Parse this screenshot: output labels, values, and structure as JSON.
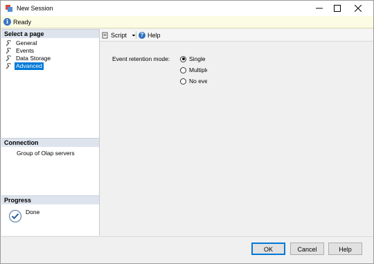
{
  "window": {
    "title": "New Session"
  },
  "status": {
    "text": "Ready"
  },
  "select_page": {
    "header": "Select a page",
    "items": [
      {
        "label": "General",
        "selected": false
      },
      {
        "label": "Events",
        "selected": false
      },
      {
        "label": "Data Storage",
        "selected": false
      },
      {
        "label": "Advanced",
        "selected": true
      }
    ]
  },
  "connection": {
    "header": "Connection",
    "value": "Group of Olap servers"
  },
  "progress": {
    "header": "Progress",
    "value": "Done"
  },
  "toolbar": {
    "script_label": "Script",
    "help_label": "Help"
  },
  "form": {
    "label": "Event retention mode:",
    "options": [
      {
        "label": "Single event loss",
        "checked": true
      },
      {
        "label": "Multiple event loss",
        "checked": false
      },
      {
        "label": "No event loss",
        "checked": false
      }
    ]
  },
  "buttons": {
    "ok": "OK",
    "cancel": "Cancel",
    "help": "Help"
  }
}
